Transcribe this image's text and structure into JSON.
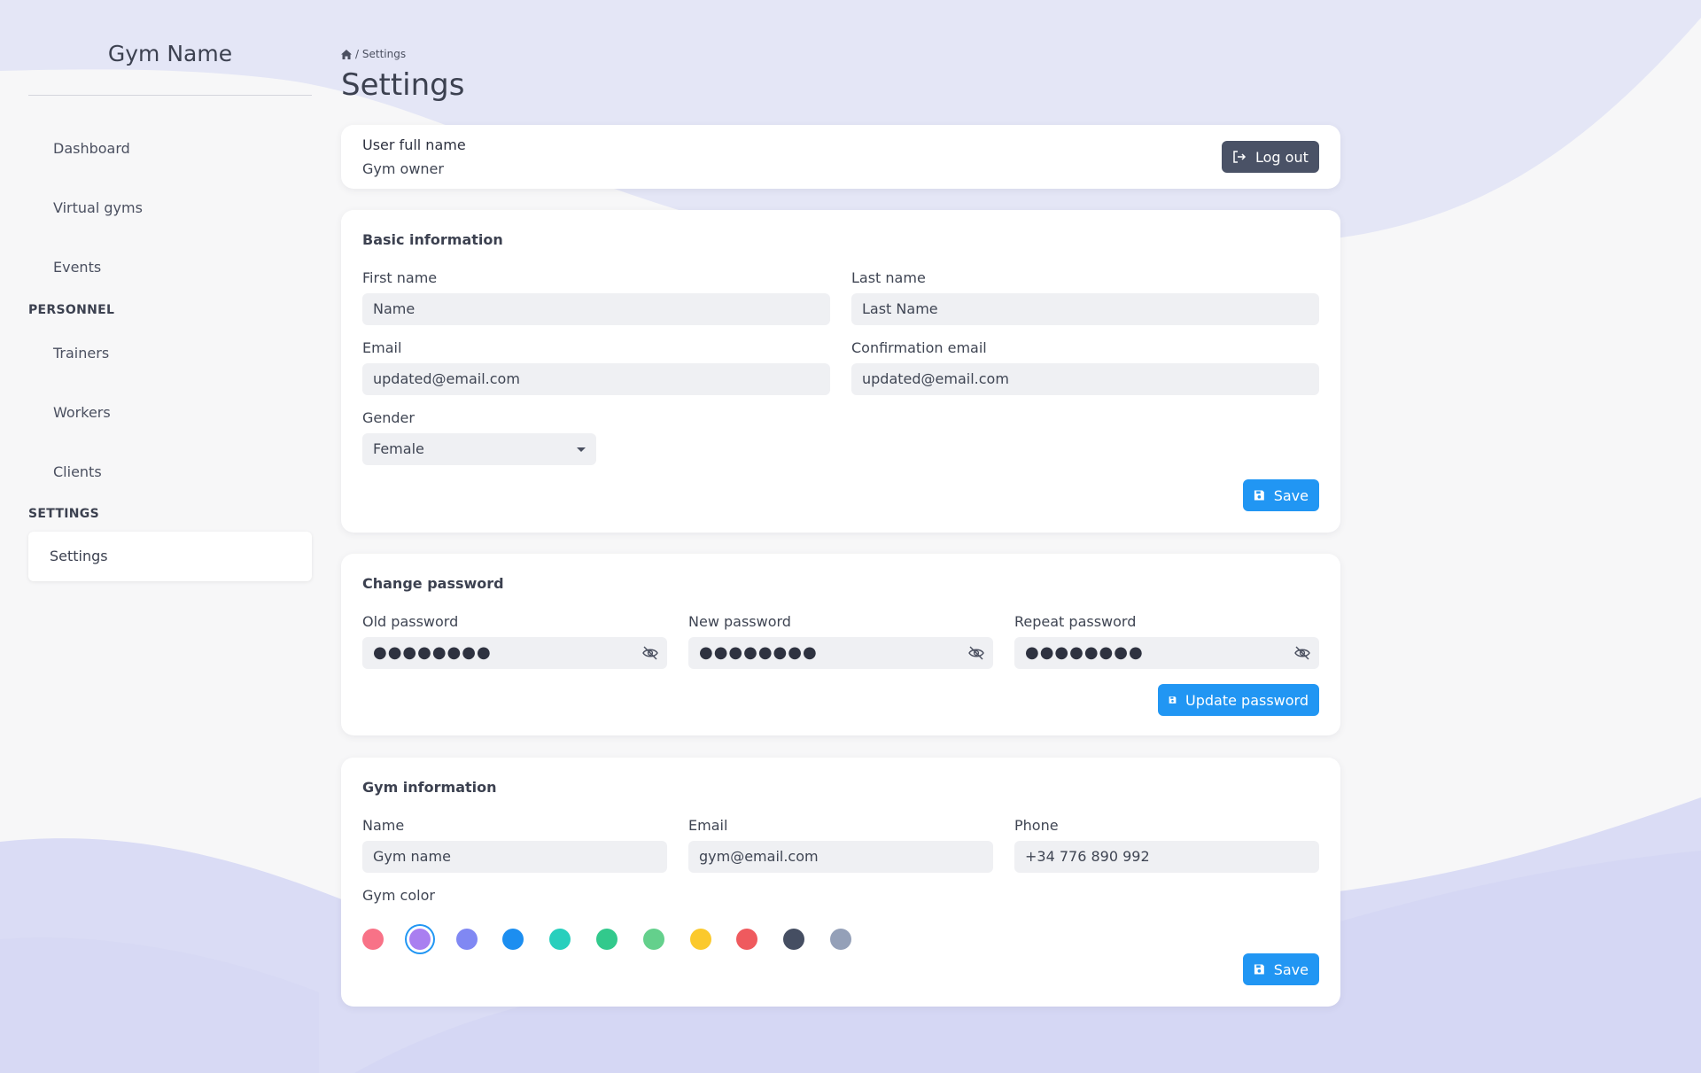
{
  "sidebar": {
    "brand": "Gym Name",
    "items": [
      {
        "label": "Dashboard"
      },
      {
        "label": "Virtual gyms"
      },
      {
        "label": "Events"
      }
    ],
    "personnel_section": "PERSONNEL",
    "personnel_items": [
      {
        "label": "Trainers"
      },
      {
        "label": "Workers"
      },
      {
        "label": "Clients"
      }
    ],
    "settings_section": "SETTINGS",
    "active_item": "Settings"
  },
  "header": {
    "breadcrumb": "/ Settings",
    "title": "Settings"
  },
  "user_card": {
    "name": "User full name",
    "role": "Gym owner",
    "logout_label": "Log out"
  },
  "basic_info": {
    "title": "Basic information",
    "first_name_label": "First name",
    "first_name_value": "Name",
    "last_name_label": "Last name",
    "last_name_value": "Last Name",
    "email_label": "Email",
    "email_value": "updated@email.com",
    "confirm_email_label": "Confirmation email",
    "confirm_email_value": "updated@email.com",
    "gender_label": "Gender",
    "gender_value": "Female",
    "save_label": "Save"
  },
  "password": {
    "title": "Change password",
    "old_label": "Old password",
    "new_label": "New password",
    "repeat_label": "Repeat password",
    "masked": "●●●●●●●●",
    "update_label": "Update password"
  },
  "gym_info": {
    "title": "Gym information",
    "name_label": "Name",
    "name_value": "Gym name",
    "email_label": "Email",
    "email_value": "gym@email.com",
    "phone_label": "Phone",
    "phone_value": "+34 776 890 992",
    "color_label": "Gym color",
    "colors": [
      "#f87287",
      "#a97ff0",
      "#8088f3",
      "#1c8ef0",
      "#28cfbd",
      "#32c98c",
      "#64d08c",
      "#fbc92c",
      "#ef5a5e",
      "#454e62",
      "#94a0b8"
    ],
    "selected_color": "#a97ff0",
    "save_label": "Save"
  },
  "theme": {
    "accent": "#2196f3",
    "dark_button": "#4a5266",
    "background_wave": "#e3e5f6"
  }
}
